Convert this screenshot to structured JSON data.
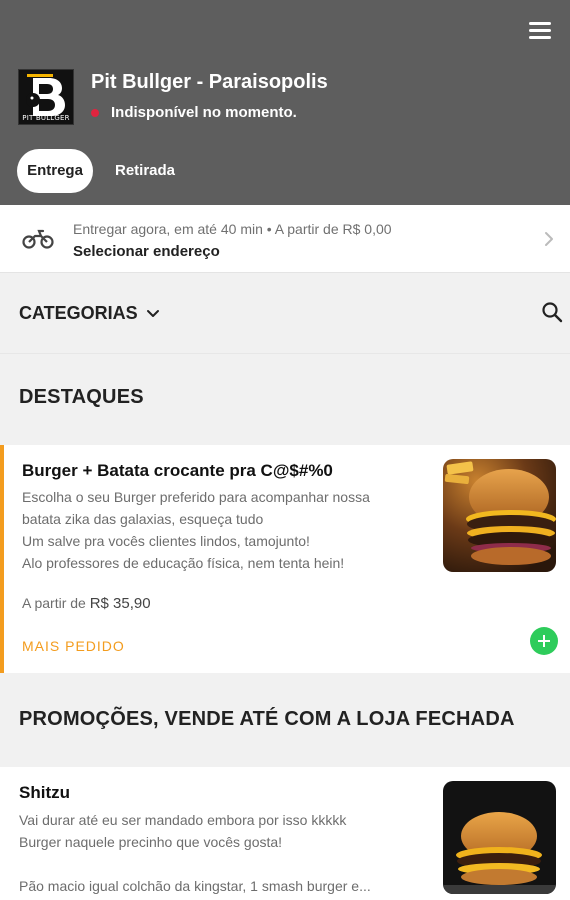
{
  "header": {
    "store_name": "Pit Bullger - Paraisopolis",
    "status": "Indisponível no momento.",
    "logo_text": "PIT BULLGER",
    "menu_icon": "hamburger-menu-icon",
    "tabs": {
      "delivery": "Entrega",
      "pickup": "Retirada"
    },
    "colors": {
      "background": "#5e5e5e",
      "status_dot": "#e0243f"
    }
  },
  "delivery": {
    "info": "Entregar agora, em até 40 min  •  A partir de R$ 0,00",
    "address_label": "Selecionar endereço",
    "icon": "motorcycle-icon"
  },
  "categories": {
    "label": "CATEGORIAS",
    "icons": [
      "chevron-down-icon",
      "search-icon"
    ]
  },
  "sections": [
    {
      "title": "DESTAQUES",
      "items": [
        {
          "name": "Burger + Batata crocante pra C@$#%0",
          "description": [
            "Escolha o seu Burger preferido para acompanhar nossa",
            "batata zika das galaxias, esqueça tudo",
            "Um salve pra vocês clientes lindos, tamojunto!",
            "Alo professores de educação física, nem tenta hein!"
          ],
          "price_prefix": "A partir de",
          "price": "R$ 35,90",
          "badge": "MAIS PEDIDO",
          "accent_color": "#f39c1e"
        }
      ]
    },
    {
      "title": "PROMOÇÕES, VENDE ATÉ COM A LOJA FECHADA",
      "items": [
        {
          "name": "Shitzu",
          "description": [
            "Vai durar até eu ser mandado embora por isso kkkkk",
            "Burger naquele precinho que vocês gosta!",
            "",
            "Pão macio igual colchão da kingstar, 1 smash burger e..."
          ]
        }
      ]
    }
  ]
}
